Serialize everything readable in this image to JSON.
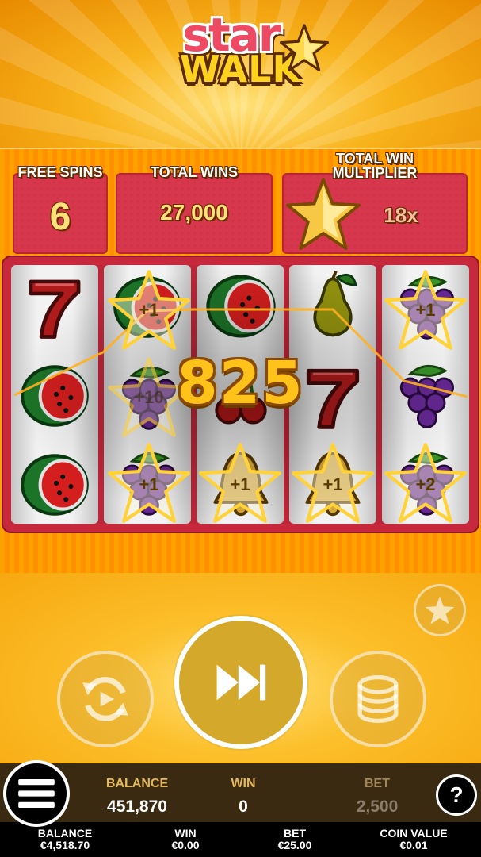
{
  "logo": {
    "line1": "star",
    "line2": "WALK"
  },
  "info": {
    "free_spins_label": "FREE SPINS",
    "free_spins_value": "6",
    "total_wins_label": "TOTAL WINS",
    "total_wins_value": "27,000",
    "multiplier_label_line1": "TOTAL WIN",
    "multiplier_label_line2": "MULTIPLIER",
    "multiplier_value": "18x"
  },
  "reels": [
    [
      "seven-icon",
      "watermelon-icon",
      "watermelon-icon"
    ],
    [
      "watermelon-icon",
      "grapes-icon",
      "grapes-icon"
    ],
    [
      "watermelon-icon",
      "cherry-icon",
      "bell-icon"
    ],
    [
      "pear-icon",
      "seven-icon",
      "bell-icon"
    ],
    [
      "grapes-icon",
      "grapes-icon",
      "grapes-icon"
    ]
  ],
  "star_bonuses": [
    {
      "reel": 2,
      "row": 1,
      "label": "+1"
    },
    {
      "reel": 2,
      "row": 2,
      "label": "+10"
    },
    {
      "reel": 2,
      "row": 3,
      "label": "+1"
    },
    {
      "reel": 3,
      "row": 3,
      "label": "+1"
    },
    {
      "reel": 4,
      "row": 3,
      "label": "+1"
    },
    {
      "reel": 5,
      "row": 1,
      "label": "+1"
    },
    {
      "reel": 5,
      "row": 3,
      "label": "+2"
    }
  ],
  "win_amount": "825",
  "hud": {
    "balance_label": "BALANCE",
    "balance_value": "451,870",
    "win_label": "WIN",
    "win_value": "0",
    "bet_label": "BET",
    "bet_value": "2,500",
    "help_label": "?"
  },
  "footer": {
    "balance_label": "BALANCE",
    "balance_value": "€4,518.70",
    "win_label": "WIN",
    "win_value": "€0.00",
    "bet_label": "BET",
    "bet_value": "€25.00",
    "coin_label": "COIN VALUE",
    "coin_value": "€0.01"
  },
  "colors": {
    "accent": "#ffc21a",
    "panel_red": "#d7374c",
    "hud_bg": "#3a2a12"
  }
}
